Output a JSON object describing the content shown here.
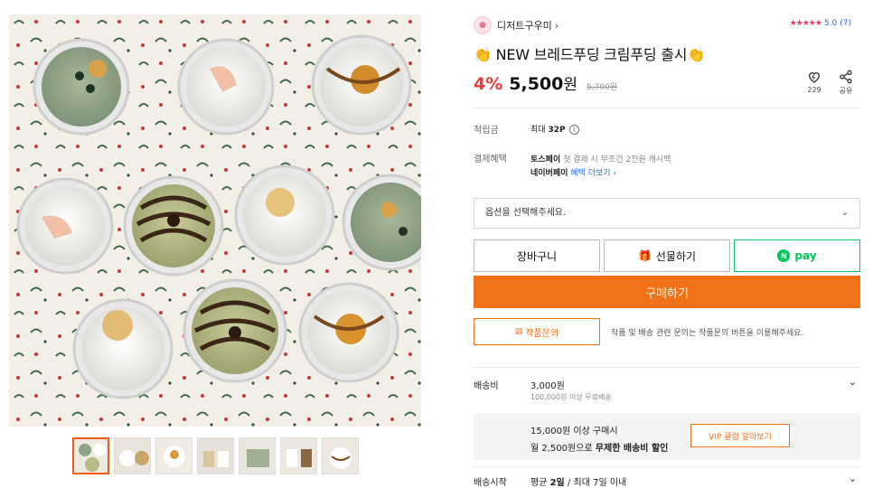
{
  "gallery": {
    "main_alt": "product-photo",
    "thumbnail_count": 7
  },
  "seller": {
    "name": "디저트구우미",
    "chevron": "›"
  },
  "rating": {
    "stars": "★★★★★",
    "score": "5.0",
    "count": "(7)"
  },
  "product": {
    "title": "👏 NEW 브레드푸딩 크림푸딩 출시👏",
    "discount": "4%",
    "price": "5,500",
    "price_unit": "원",
    "original_price": "5,700원"
  },
  "actions": {
    "like_icon": "heart-icon",
    "like_count": "229",
    "share_icon": "share-icon",
    "share_label": "공유"
  },
  "points": {
    "label": "적립금",
    "value_prefix": "최대",
    "value": "32P"
  },
  "payment": {
    "label": "결제혜택",
    "toss_name": "토스페이",
    "toss_text": "첫 결제 시 무조건 2천원 캐시백",
    "naver_name": "네이버페이",
    "naver_link": "혜택 더보기 ›"
  },
  "option": {
    "placeholder": "옵션을 선택해주세요."
  },
  "buttons": {
    "cart": "장바구니",
    "gift": "선물하기",
    "npay_badge": "N",
    "npay": "pay",
    "buy": "구매하기",
    "inquiry": "작품문의",
    "inquiry_desc": "작품 및 배송 관련 문의는 작품문의 버튼을 이용해주세요."
  },
  "shipping": {
    "label": "배송비",
    "fee": "3,000원",
    "free_note": "100,000원 이상 무료배송",
    "vip_line1": "15,000원 이상 구매시",
    "vip_line2_prefix": "월 2,500원으로",
    "vip_line2_bold": "무제한 배송비 할인",
    "vip_button": "VIP 클럽 알아보기"
  },
  "delivery": {
    "label": "배송시작",
    "prefix": "평균",
    "avg": "2일",
    "max": "/ 최대 7일 이내"
  },
  "colors": {
    "accent": "#f07118",
    "discount": "#f03a3a",
    "npay": "#03c75a",
    "link": "#2a6bd8"
  }
}
